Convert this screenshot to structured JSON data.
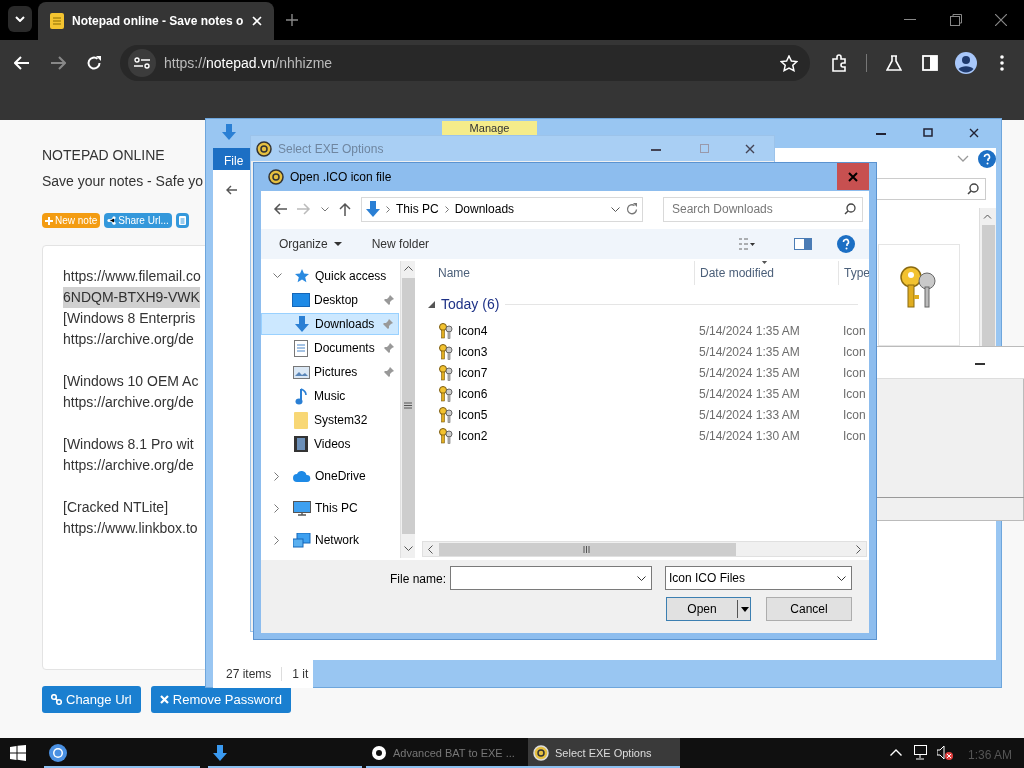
{
  "browser": {
    "tab_title": "Notepad online - Save notes o",
    "url_scheme": "https://",
    "url_host": "notepad.vn",
    "url_path": "/nhhizme"
  },
  "notepad": {
    "title": "NOTEPAD ONLINE",
    "subtitle": "Save your notes - Safe yo",
    "tool_buttons": [
      {
        "kind": "new",
        "label": "New note",
        "color": "#f39c12"
      },
      {
        "kind": "share",
        "label": "Share Url...",
        "color": "#3498db"
      },
      {
        "kind": "doc",
        "color": "#3498db"
      }
    ],
    "note_paragraphs": [
      [
        {
          "text": "https://www.filemail.co",
          "selected": false
        },
        {
          "text": "6NDQM-BTXH9-VWK",
          "selected": true
        },
        {
          "text": "[Windows 8 Enterpris",
          "selected": false
        },
        {
          "text": "https://archive.org/de",
          "selected": false
        }
      ],
      [
        {
          "text": "[Windows 10 OEM Ac",
          "selected": false
        },
        {
          "text": "https://archive.org/de",
          "selected": false
        }
      ],
      [
        {
          "text": "[Windows 8.1 Pro wit",
          "selected": false
        },
        {
          "text": "https://archive.org/de",
          "selected": false
        }
      ],
      [
        {
          "text": "[Cracked NTLite]",
          "selected": false
        },
        {
          "text": "https://www.linkbox.to",
          "selected": false
        }
      ]
    ],
    "bottom_buttons": [
      {
        "kind": "link",
        "label": "Change Url"
      },
      {
        "kind": "remove",
        "label": "Remove Password"
      }
    ]
  },
  "explorer": {
    "file_tab": "File",
    "manage_tab": "Manage",
    "status": [
      "27 items",
      "1 it"
    ]
  },
  "select_exe": {
    "title": "Select EXE Options"
  },
  "dialog": {
    "title": "Open .ICO icon file",
    "breadcrumb": [
      "This PC",
      "Downloads"
    ],
    "search_placeholder": "Search Downloads",
    "organize": "Organize",
    "new_folder": "New folder",
    "nav": [
      {
        "label": "Quick access",
        "kind": "star",
        "expanded": true,
        "children": [
          {
            "label": "Desktop",
            "kind": "desktop",
            "pinned": true,
            "selected": false
          },
          {
            "label": "Downloads",
            "kind": "download",
            "pinned": true,
            "selected": true
          },
          {
            "label": "Documents",
            "kind": "document",
            "pinned": true,
            "selected": false
          },
          {
            "label": "Pictures",
            "kind": "pictures",
            "pinned": true,
            "selected": false
          },
          {
            "label": "Music",
            "kind": "music",
            "pinned": false,
            "selected": false
          },
          {
            "label": "System32",
            "kind": "folder",
            "pinned": false,
            "selected": false
          },
          {
            "label": "Videos",
            "kind": "video",
            "pinned": false,
            "selected": false
          }
        ]
      },
      {
        "label": "OneDrive",
        "kind": "cloud",
        "expanded": false
      },
      {
        "label": "This PC",
        "kind": "pc",
        "expanded": false
      },
      {
        "label": "Network",
        "kind": "network",
        "expanded": false
      }
    ],
    "columns": [
      "Name",
      "Date modified",
      "Type"
    ],
    "group": "Today (6)",
    "files": [
      {
        "name": "Icon4",
        "date": "5/14/2024 1:35 AM",
        "type": "Icon"
      },
      {
        "name": "Icon3",
        "date": "5/14/2024 1:35 AM",
        "type": "Icon"
      },
      {
        "name": "Icon7",
        "date": "5/14/2024 1:35 AM",
        "type": "Icon"
      },
      {
        "name": "Icon6",
        "date": "5/14/2024 1:35 AM",
        "type": "Icon"
      },
      {
        "name": "Icon5",
        "date": "5/14/2024 1:33 AM",
        "type": "Icon"
      },
      {
        "name": "Icon2",
        "date": "5/14/2024 1:30 AM",
        "type": "Icon"
      }
    ],
    "file_name_label": "File name:",
    "file_type": "Icon ICO Files",
    "open_button": "Open",
    "cancel_button": "Cancel"
  },
  "taskbar": {
    "items": [
      {
        "kind": "chrome",
        "selected": false
      },
      {
        "kind": "explorer",
        "selected": false
      },
      {
        "kind": "bat",
        "label": "Advanced BAT to EXE ...",
        "selected": false
      },
      {
        "kind": "exe",
        "label": "Select EXE Options",
        "selected": true
      }
    ],
    "clock": "1:36 AM"
  }
}
